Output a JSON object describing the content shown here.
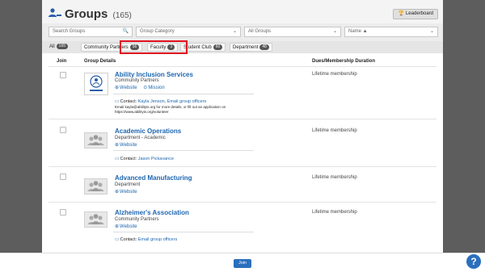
{
  "header": {
    "title": "Groups",
    "count": "(165)",
    "leaderboard_label": "Leaderboard"
  },
  "filters": {
    "search_placeholder": "Search Groups",
    "category": "Group Category",
    "groups": "All Groups",
    "sort": "Name ▲"
  },
  "tabs": [
    {
      "label": "All",
      "count": "165"
    },
    {
      "label": "Community Partners",
      "count": "56"
    },
    {
      "label": "Faculty",
      "count": "3"
    },
    {
      "label": "Student Club",
      "count": "60"
    },
    {
      "label": "Department",
      "count": "48"
    }
  ],
  "columns": {
    "join": "Join",
    "details": "Group Details",
    "dues": "Dues/Membership Duration"
  },
  "rows": [
    {
      "name": "Ability Inclusion Services",
      "sub": "Community Partners",
      "website": "Website",
      "mission": "Mission",
      "contact_prefix": "Contact:",
      "contact": "Kayla Jenson, Email group officers",
      "note": "Email kayla@abilityis.org for more details, or fill out an application on https://www.abilityis.org/volunteer",
      "dues": "Lifetime membership"
    },
    {
      "name": "Academic Operations",
      "sub": "Department - Academic",
      "website": "Website",
      "contact_prefix": "Contact:",
      "contact": "Jason Pickavance",
      "dues": "Lifetime membership"
    },
    {
      "name": "Advanced Manufacturing",
      "sub": "Department",
      "website": "Website",
      "dues": "Lifetime membership"
    },
    {
      "name": "Alzheimer's Association",
      "sub": "Community Partners",
      "website": "Website",
      "contact_prefix": "Contact:",
      "contact": "Email group officers",
      "dues": "Lifetime membership"
    }
  ],
  "footer": {
    "join_label": "Join",
    "help_label": "?"
  },
  "colors": {
    "accent": "#2a6fbe",
    "highlight": "#e01020",
    "link": "#1e66b0"
  }
}
